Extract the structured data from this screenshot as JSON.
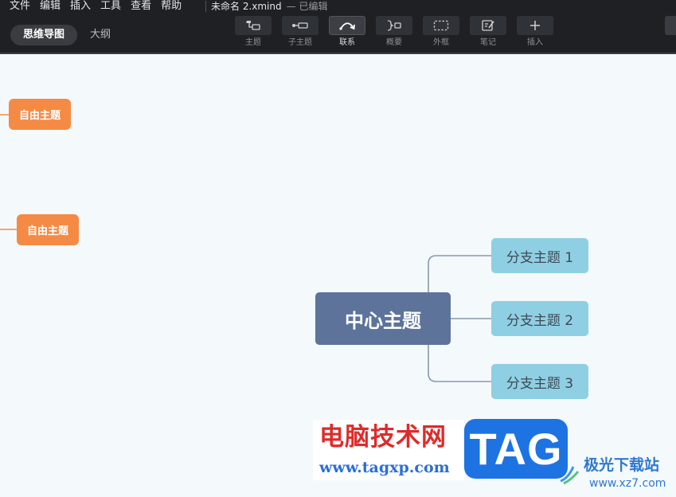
{
  "menu": [
    "文件",
    "编辑",
    "插入",
    "工具",
    "查看",
    "帮助"
  ],
  "document": {
    "filename": "未命名 2.xmind",
    "status": "— 已编辑"
  },
  "view_tabs": [
    {
      "label": "思维导图",
      "active": true
    },
    {
      "label": "大纲",
      "active": false
    }
  ],
  "toolbar": [
    {
      "label": "主题",
      "icon": "topic-icon"
    },
    {
      "label": "子主题",
      "icon": "subtopic-icon"
    },
    {
      "label": "联系",
      "icon": "relationship-icon",
      "active": true
    },
    {
      "label": "概要",
      "icon": "summary-icon"
    },
    {
      "label": "外框",
      "icon": "boundary-icon"
    },
    {
      "label": "笔记",
      "icon": "notes-icon"
    },
    {
      "label": "插入",
      "icon": "plus-icon"
    }
  ],
  "map": {
    "central": "中心主题",
    "branches": [
      "分支主题 1",
      "分支主题 2",
      "分支主题 3"
    ],
    "free_topics": [
      "自由主题",
      "自由主题"
    ]
  },
  "watermark": {
    "site_name": "电脑技术网",
    "site_url": "www.tagxp.com",
    "tag": "TAG",
    "site2_name": "极光下载站",
    "site2_url": "www.xz7.com"
  },
  "colors": {
    "topbar": "#1e2024",
    "canvas": "#f4f9fc",
    "central": "#5d739a",
    "branch": "#8fcfe3",
    "free_topic": "#f58a45",
    "connector": "#8a99ab"
  }
}
